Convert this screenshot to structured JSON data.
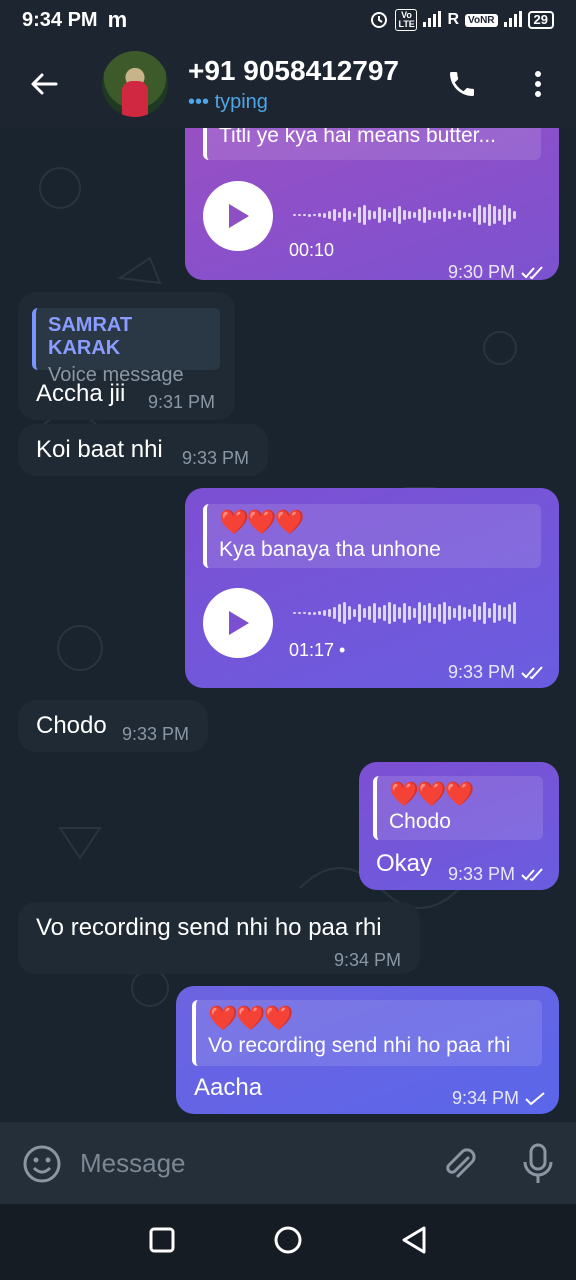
{
  "status": {
    "time": "9:34 PM",
    "carrier_logo": "m",
    "network_labels": "R",
    "volte_label": "Vo LTE",
    "vonr_label": "VoNR",
    "battery": "29"
  },
  "header": {
    "contact": "+91 9058412797",
    "status": "••• typing"
  },
  "messages": {
    "m1": {
      "reply_text": "Titli ye kya hai means butter...",
      "duration": "00:10",
      "time": "9:30 PM"
    },
    "m2": {
      "reply_author": "SAMRAT KARAK",
      "reply_text": "Voice message",
      "text": "Accha jii",
      "time": "9:31 PM"
    },
    "m3": {
      "text": "Koi baat nhi",
      "time": "9:33 PM"
    },
    "m4": {
      "reply_hearts": "❤️❤️❤️",
      "reply_text": "Kya banaya tha unhone",
      "duration": "01:17 •",
      "time": "9:33 PM"
    },
    "m5": {
      "text": "Chodo",
      "time": "9:33 PM"
    },
    "m6": {
      "reply_hearts": "❤️❤️❤️",
      "reply_text": "Chodo",
      "text": "Okay",
      "time": "9:33 PM"
    },
    "m7": {
      "text": "Vo recording send nhi ho paa rhi",
      "time": "9:34 PM"
    },
    "m8": {
      "reply_hearts": "❤️❤️❤️",
      "reply_text": "Vo recording send nhi ho paa rhi",
      "text": "Aacha",
      "time": "9:34 PM"
    }
  },
  "input": {
    "placeholder": "Message"
  },
  "icons": {
    "back": "arrow-left-icon",
    "call": "phone-icon",
    "more": "more-vert-icon",
    "emoji": "smile-icon",
    "attach": "paperclip-icon",
    "mic": "mic-icon",
    "play": "play-icon",
    "read": "double-check-icon",
    "sent": "check-icon"
  },
  "colors": {
    "header_bg": "#1c2530",
    "accent": "#4fa5e6",
    "outgoing_purple": "#9a4fc4",
    "outgoing_blue": "#5b66ea",
    "incoming": "#1f2a35",
    "heart": "#e0243a"
  }
}
